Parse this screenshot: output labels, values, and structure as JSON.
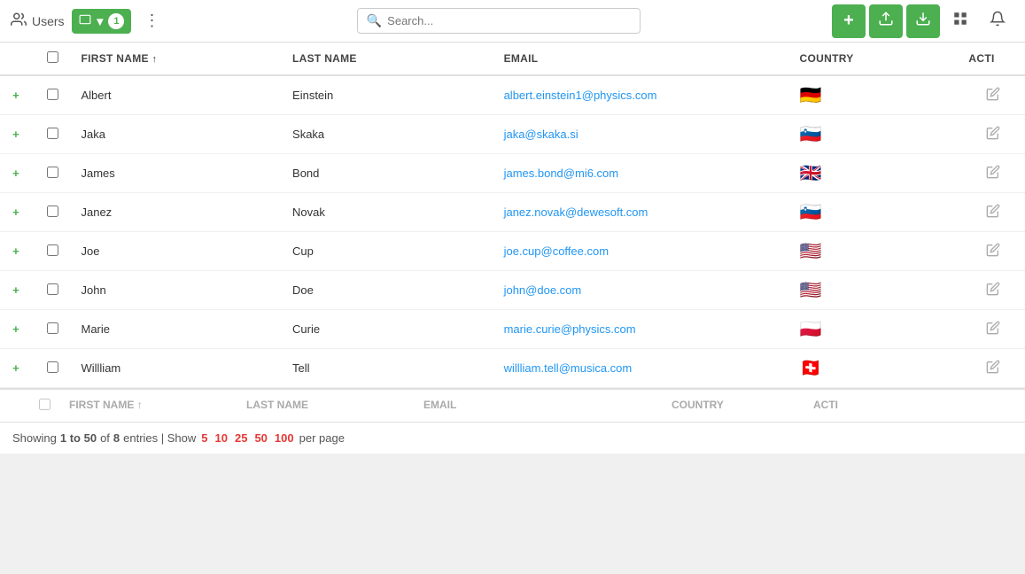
{
  "toolbar": {
    "users_label": "Users",
    "filter_count": "1",
    "search_placeholder": "Search...",
    "add_label": "+",
    "import_label": "⬆",
    "export_label": "⬇",
    "grid_label": "⊞",
    "bell_label": "🔔"
  },
  "table": {
    "columns": {
      "first_name": "FIRST NAME",
      "last_name": "LAST NAME",
      "email": "EMAIL",
      "country": "COUNTRY",
      "action": "ACTI"
    },
    "rows": [
      {
        "first": "Albert",
        "last": "Einstein",
        "email": "albert.einstein1@physics.com",
        "country_flag": "🇩🇪",
        "country_code": "DE"
      },
      {
        "first": "Jaka",
        "last": "Skaka",
        "email": "jaka@skaka.si",
        "country_flag": "🇸🇮",
        "country_code": "SI"
      },
      {
        "first": "James",
        "last": "Bond",
        "email": "james.bond@mi6.com",
        "country_flag": "🇬🇧",
        "country_code": "GB"
      },
      {
        "first": "Janez",
        "last": "Novak",
        "email": "janez.novak@dewesoft.com",
        "country_flag": "🇸🇮",
        "country_code": "SI"
      },
      {
        "first": "Joe",
        "last": "Cup",
        "email": "joe.cup@coffee.com",
        "country_flag": "🇺🇸",
        "country_code": "US"
      },
      {
        "first": "John",
        "last": "Doe",
        "email": "john@doe.com",
        "country_flag": "🇺🇸",
        "country_code": "US"
      },
      {
        "first": "Marie",
        "last": "Curie",
        "email": "marie.curie@physics.com",
        "country_flag": "🇵🇱",
        "country_code": "PL"
      },
      {
        "first": "Willliam",
        "last": "Tell",
        "email": "willliam.tell@musica.com",
        "country_flag": "🇨🇭",
        "country_code": "CH"
      }
    ]
  },
  "footer": {
    "showing_text": "Showing",
    "range": "1 to 50",
    "of_text": "of",
    "total": "8",
    "entries_text": "entries | Show",
    "per_page_options": [
      "5",
      "10",
      "25",
      "50",
      "100"
    ],
    "per_page_suffix": "per page",
    "first_name_footer": "FIRST NAME",
    "last_name_footer": "LAST NAME",
    "email_footer": "EMAIL",
    "country_footer": "COUNTRY",
    "action_footer": "ACTI"
  }
}
